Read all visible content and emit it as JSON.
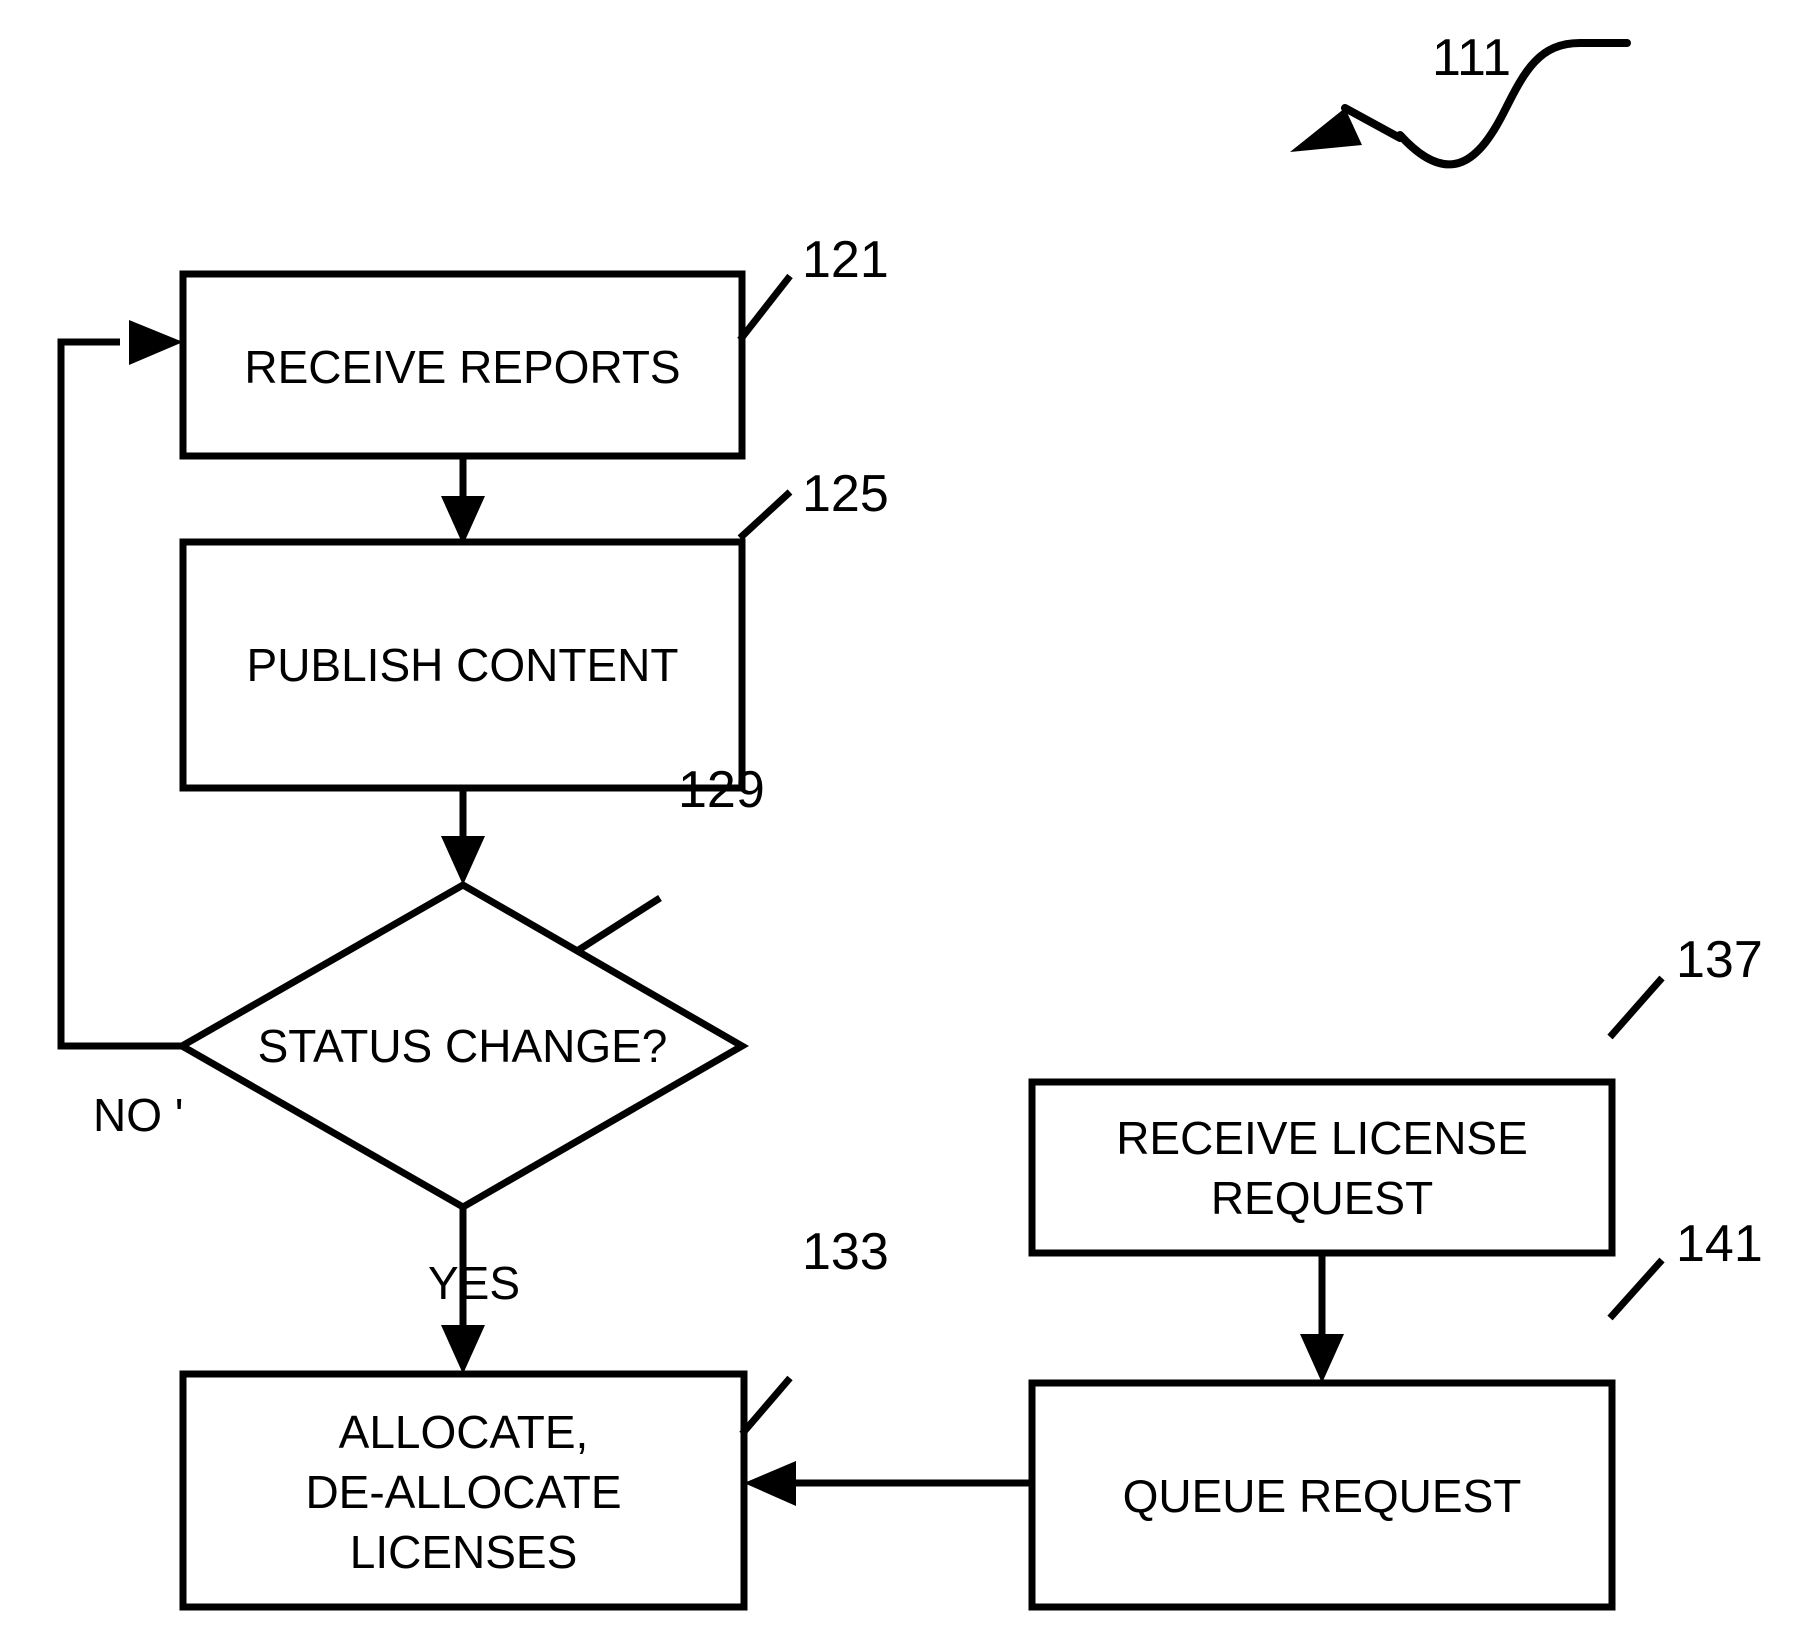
{
  "figure": {
    "reference_numeral": "111",
    "nodes": [
      {
        "id": "receive-reports",
        "label": "RECEIVE REPORTS",
        "ref": "121",
        "shape": "rect"
      },
      {
        "id": "publish-content",
        "label": "PUBLISH CONTENT",
        "ref": "125",
        "shape": "rect"
      },
      {
        "id": "status-change",
        "label": "STATUS CHANGE?",
        "ref": "129",
        "shape": "diamond"
      },
      {
        "id": "allocate-licenses",
        "label": "ALLOCATE,\nDE-ALLOCATE\nLICENSES",
        "ref": "133",
        "shape": "rect"
      },
      {
        "id": "receive-license-request",
        "label": "RECEIVE LICENSE\nREQUEST",
        "ref": "137",
        "shape": "rect"
      },
      {
        "id": "queue-request",
        "label": "QUEUE REQUEST",
        "ref": "141",
        "shape": "rect"
      }
    ],
    "edge_labels": {
      "no": "NO '",
      "yes": "YES"
    },
    "colors": {
      "stroke": "#000000",
      "background": "#ffffff",
      "text": "#000000"
    }
  }
}
